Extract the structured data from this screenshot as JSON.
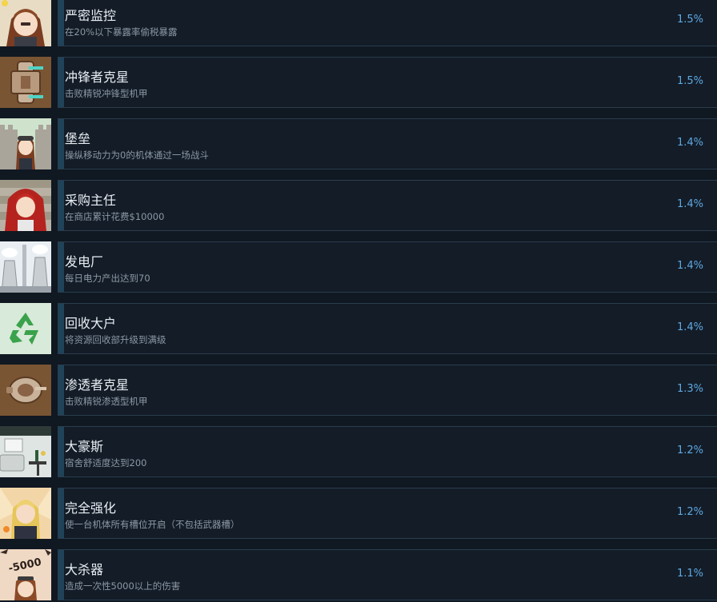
{
  "achievements": [
    {
      "title": "严密监控",
      "description": "在20%以下暴露率偷税暴露",
      "percent": "1.5%",
      "icon": "girl-camera-icon"
    },
    {
      "title": "冲锋者克星",
      "description": "击败精锐冲锋型机甲",
      "percent": "1.5%",
      "icon": "charger-mech-icon"
    },
    {
      "title": "堡垒",
      "description": "操纵移动力为0的机体通过一场战斗",
      "percent": "1.4%",
      "icon": "fortress-girl-icon"
    },
    {
      "title": "采购主任",
      "description": "在商店累计花费$10000",
      "percent": "1.4%",
      "icon": "red-hair-girl-icon"
    },
    {
      "title": "发电厂",
      "description": "每日电力产出达到70",
      "percent": "1.4%",
      "icon": "power-plant-icon"
    },
    {
      "title": "回收大户",
      "description": "将资源回收部升级到满级",
      "percent": "1.4%",
      "icon": "recycle-icon"
    },
    {
      "title": "渗透者克星",
      "description": "击败精锐渗透型机甲",
      "percent": "1.3%",
      "icon": "infiltrator-mech-icon"
    },
    {
      "title": "大豪斯",
      "description": "宿舍舒适度达到200",
      "percent": "1.2%",
      "icon": "dorm-room-icon"
    },
    {
      "title": "完全强化",
      "description": "使一台机体所有槽位开启（不包括武器槽）",
      "percent": "1.2%",
      "icon": "blonde-girl-icon"
    },
    {
      "title": "大杀器",
      "description": "造成一次性5000以上的伤害",
      "percent": "1.1%",
      "icon": "damage-5000-icon",
      "icon_text": "-5000"
    }
  ],
  "colors": {
    "background": "#101822",
    "panel": "#131c27",
    "accent_bar": "#1f4358",
    "percent_text": "#5fa9e3"
  }
}
